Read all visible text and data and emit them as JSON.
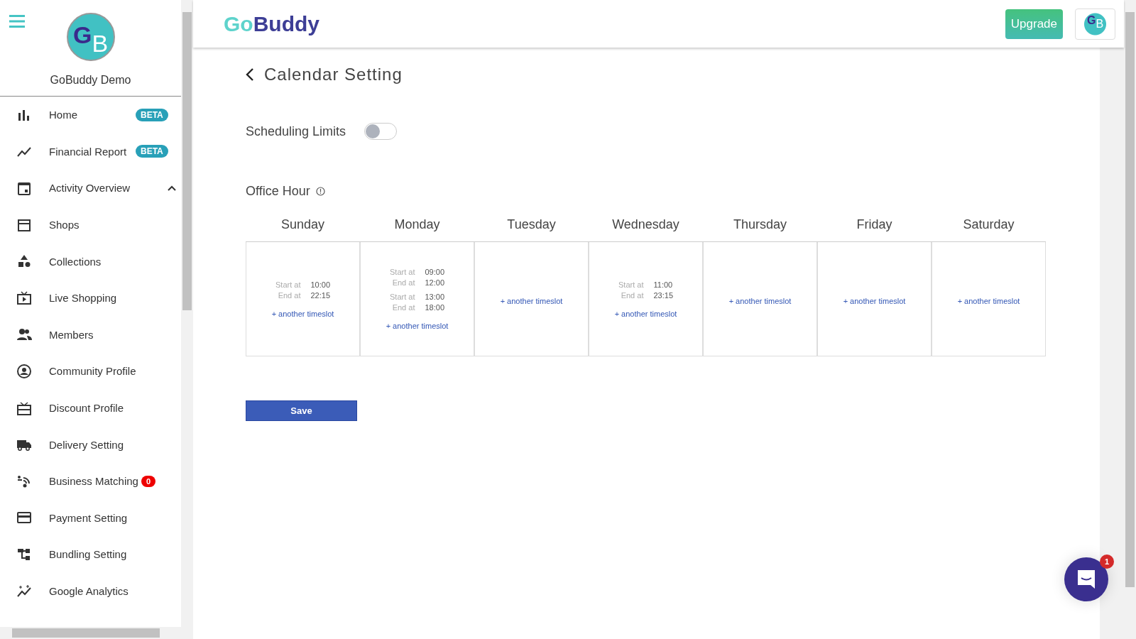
{
  "sidebar": {
    "avatar": {
      "letter_1": "G",
      "letter_2": "B"
    },
    "name": "GoBuddy Demo",
    "items": [
      {
        "label": "Home",
        "badge": {
          "kind": "beta",
          "text": "BETA"
        }
      },
      {
        "label": "Financial Report",
        "badge": {
          "kind": "beta",
          "text": "BETA"
        }
      },
      {
        "label": "Activity Overview",
        "expanded": true
      },
      {
        "label": "Shops"
      },
      {
        "label": "Collections"
      },
      {
        "label": "Live Shopping"
      },
      {
        "label": "Members"
      },
      {
        "label": "Community Profile"
      },
      {
        "label": "Discount Profile"
      },
      {
        "label": "Delivery Setting"
      },
      {
        "label": "Business Matching",
        "badge": {
          "kind": "count",
          "text": "0"
        }
      },
      {
        "label": "Payment Setting"
      },
      {
        "label": "Bundling Setting"
      },
      {
        "label": "Google Analytics"
      }
    ]
  },
  "header": {
    "logo": {
      "part_1": "Go",
      "part_2": "Buddy"
    },
    "upgrade_button": "Upgrade",
    "avatar": {
      "letter_1": "G",
      "letter_2": "B"
    }
  },
  "page": {
    "title": "Calendar Setting",
    "scheduling_limits": {
      "label": "Scheduling Limits",
      "on": false
    },
    "office_hour": {
      "label": "Office Hour"
    },
    "days": [
      {
        "name": "Sunday",
        "slots": [
          {
            "start_label": "Start at",
            "start": "10:00",
            "end_label": "End at",
            "end": "22:15"
          }
        ],
        "add_link": "+ another timeslot"
      },
      {
        "name": "Monday",
        "slots": [
          {
            "start_label": "Start at",
            "start": "09:00",
            "end_label": "End at",
            "end": "12:00"
          },
          {
            "start_label": "Start at",
            "start": "13:00",
            "end_label": "End at",
            "end": "18:00"
          }
        ],
        "add_link": "+ another timeslot"
      },
      {
        "name": "Tuesday",
        "add_link": "+ another timeslot"
      },
      {
        "name": "Wednesday",
        "slots": [
          {
            "start_label": "Start at",
            "start": "11:00",
            "end_label": "End at",
            "end": "23:15"
          }
        ],
        "add_link": "+ another timeslot"
      },
      {
        "name": "Thursday",
        "add_link": "+ another timeslot"
      },
      {
        "name": "Friday",
        "add_link": "+ another timeslot"
      },
      {
        "name": "Saturday",
        "add_link": "+ another timeslot"
      }
    ],
    "save_button": "Save"
  },
  "chat": {
    "badge": "1"
  }
}
